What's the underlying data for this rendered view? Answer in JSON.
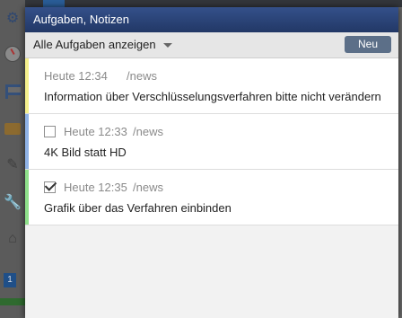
{
  "panel": {
    "title": "Aufgaben, Notizen",
    "filter_label": "Alle Aufgaben anzeigen",
    "new_button": "Neu"
  },
  "tasks": [
    {
      "time": "Heute 12:34",
      "path": "/news",
      "text": "Information über Verschlüsselungsverfahren bitte nicht verändern",
      "checkbox": false,
      "checked": false,
      "color": "#f5f08c"
    },
    {
      "time": "Heute 12:33",
      "path": "/news",
      "text": "4K Bild statt HD",
      "checkbox": true,
      "checked": false,
      "color": "#8fb2e6"
    },
    {
      "time": "Heute 12:35",
      "path": "/news",
      "text": "Grafik über das Verfahren einbinden",
      "checkbox": true,
      "checked": true,
      "color": "#8ee08a"
    }
  ],
  "sidebar": {
    "badge": "1",
    "icons": [
      "gear-icon",
      "gauge-icon",
      "tree-icon",
      "folder-icon",
      "edit-icon",
      "wrench-icon",
      "home-icon"
    ]
  }
}
